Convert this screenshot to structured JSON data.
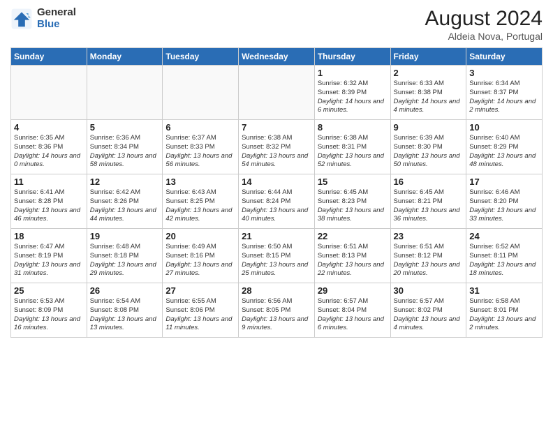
{
  "logo": {
    "general": "General",
    "blue": "Blue"
  },
  "title": "August 2024",
  "subtitle": "Aldeia Nova, Portugal",
  "weekdays": [
    "Sunday",
    "Monday",
    "Tuesday",
    "Wednesday",
    "Thursday",
    "Friday",
    "Saturday"
  ],
  "weeks": [
    [
      {
        "day": "",
        "info": ""
      },
      {
        "day": "",
        "info": ""
      },
      {
        "day": "",
        "info": ""
      },
      {
        "day": "",
        "info": ""
      },
      {
        "day": "1",
        "sunrise": "6:32 AM",
        "sunset": "8:39 PM",
        "daylight": "14 hours and 6 minutes."
      },
      {
        "day": "2",
        "sunrise": "6:33 AM",
        "sunset": "8:38 PM",
        "daylight": "14 hours and 4 minutes."
      },
      {
        "day": "3",
        "sunrise": "6:34 AM",
        "sunset": "8:37 PM",
        "daylight": "14 hours and 2 minutes."
      }
    ],
    [
      {
        "day": "4",
        "sunrise": "6:35 AM",
        "sunset": "8:36 PM",
        "daylight": "14 hours and 0 minutes."
      },
      {
        "day": "5",
        "sunrise": "6:36 AM",
        "sunset": "8:34 PM",
        "daylight": "13 hours and 58 minutes."
      },
      {
        "day": "6",
        "sunrise": "6:37 AM",
        "sunset": "8:33 PM",
        "daylight": "13 hours and 56 minutes."
      },
      {
        "day": "7",
        "sunrise": "6:38 AM",
        "sunset": "8:32 PM",
        "daylight": "13 hours and 54 minutes."
      },
      {
        "day": "8",
        "sunrise": "6:38 AM",
        "sunset": "8:31 PM",
        "daylight": "13 hours and 52 minutes."
      },
      {
        "day": "9",
        "sunrise": "6:39 AM",
        "sunset": "8:30 PM",
        "daylight": "13 hours and 50 minutes."
      },
      {
        "day": "10",
        "sunrise": "6:40 AM",
        "sunset": "8:29 PM",
        "daylight": "13 hours and 48 minutes."
      }
    ],
    [
      {
        "day": "11",
        "sunrise": "6:41 AM",
        "sunset": "8:28 PM",
        "daylight": "13 hours and 46 minutes."
      },
      {
        "day": "12",
        "sunrise": "6:42 AM",
        "sunset": "8:26 PM",
        "daylight": "13 hours and 44 minutes."
      },
      {
        "day": "13",
        "sunrise": "6:43 AM",
        "sunset": "8:25 PM",
        "daylight": "13 hours and 42 minutes."
      },
      {
        "day": "14",
        "sunrise": "6:44 AM",
        "sunset": "8:24 PM",
        "daylight": "13 hours and 40 minutes."
      },
      {
        "day": "15",
        "sunrise": "6:45 AM",
        "sunset": "8:23 PM",
        "daylight": "13 hours and 38 minutes."
      },
      {
        "day": "16",
        "sunrise": "6:45 AM",
        "sunset": "8:21 PM",
        "daylight": "13 hours and 36 minutes."
      },
      {
        "day": "17",
        "sunrise": "6:46 AM",
        "sunset": "8:20 PM",
        "daylight": "13 hours and 33 minutes."
      }
    ],
    [
      {
        "day": "18",
        "sunrise": "6:47 AM",
        "sunset": "8:19 PM",
        "daylight": "13 hours and 31 minutes."
      },
      {
        "day": "19",
        "sunrise": "6:48 AM",
        "sunset": "8:18 PM",
        "daylight": "13 hours and 29 minutes."
      },
      {
        "day": "20",
        "sunrise": "6:49 AM",
        "sunset": "8:16 PM",
        "daylight": "13 hours and 27 minutes."
      },
      {
        "day": "21",
        "sunrise": "6:50 AM",
        "sunset": "8:15 PM",
        "daylight": "13 hours and 25 minutes."
      },
      {
        "day": "22",
        "sunrise": "6:51 AM",
        "sunset": "8:13 PM",
        "daylight": "13 hours and 22 minutes."
      },
      {
        "day": "23",
        "sunrise": "6:51 AM",
        "sunset": "8:12 PM",
        "daylight": "13 hours and 20 minutes."
      },
      {
        "day": "24",
        "sunrise": "6:52 AM",
        "sunset": "8:11 PM",
        "daylight": "13 hours and 18 minutes."
      }
    ],
    [
      {
        "day": "25",
        "sunrise": "6:53 AM",
        "sunset": "8:09 PM",
        "daylight": "13 hours and 16 minutes."
      },
      {
        "day": "26",
        "sunrise": "6:54 AM",
        "sunset": "8:08 PM",
        "daylight": "13 hours and 13 minutes."
      },
      {
        "day": "27",
        "sunrise": "6:55 AM",
        "sunset": "8:06 PM",
        "daylight": "13 hours and 11 minutes."
      },
      {
        "day": "28",
        "sunrise": "6:56 AM",
        "sunset": "8:05 PM",
        "daylight": "13 hours and 9 minutes."
      },
      {
        "day": "29",
        "sunrise": "6:57 AM",
        "sunset": "8:04 PM",
        "daylight": "13 hours and 6 minutes."
      },
      {
        "day": "30",
        "sunrise": "6:57 AM",
        "sunset": "8:02 PM",
        "daylight": "13 hours and 4 minutes."
      },
      {
        "day": "31",
        "sunrise": "6:58 AM",
        "sunset": "8:01 PM",
        "daylight": "13 hours and 2 minutes."
      }
    ]
  ]
}
